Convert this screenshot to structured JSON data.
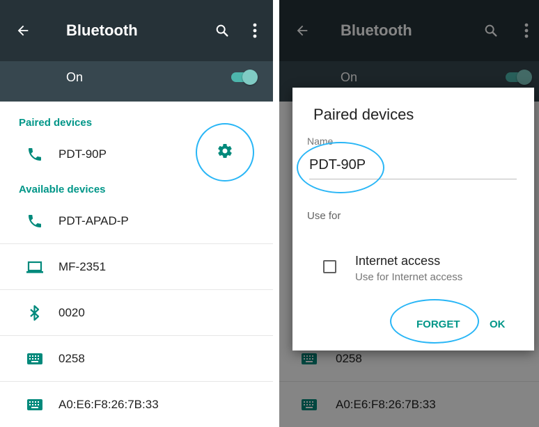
{
  "colors": {
    "toolbar": "#263238",
    "switch_bar": "#37474f",
    "accent": "#009688",
    "highlight": "#29b6f6"
  },
  "left": {
    "toolbar": {
      "title": "Bluetooth",
      "back_icon": "arrow-back-icon",
      "search_icon": "search-icon",
      "more_icon": "more-vert-icon"
    },
    "switch": {
      "label": "On",
      "on": true
    },
    "paired_header": "Paired devices",
    "paired_devices": [
      {
        "name": "PDT-90P",
        "icon": "phone-icon"
      }
    ],
    "available_header": "Available devices",
    "available_devices": [
      {
        "name": "PDT-APAD-P",
        "icon": "phone-icon"
      },
      {
        "name": "MF-2351",
        "icon": "laptop-icon"
      },
      {
        "name": "0020",
        "icon": "bluetooth-icon"
      },
      {
        "name": "0258",
        "icon": "keyboard-icon"
      },
      {
        "name": "A0:E6:F8:26:7B:33",
        "icon": "keyboard-icon"
      }
    ],
    "settings_icon": "gear-icon"
  },
  "right": {
    "toolbar": {
      "title": "Bluetooth"
    },
    "switch": {
      "label": "On",
      "on": true
    },
    "visible_devices": [
      {
        "name": "0258",
        "icon": "keyboard-icon"
      },
      {
        "name": "A0:E6:F8:26:7B:33",
        "icon": "keyboard-icon"
      }
    ],
    "dialog": {
      "title": "Paired devices",
      "name_label": "Name",
      "name_value": "PDT-90P",
      "use_for_label": "Use for",
      "option_title": "Internet access",
      "option_subtitle": "Use for Internet access",
      "option_checked": false,
      "forget_label": "FORGET",
      "ok_label": "OK"
    }
  }
}
